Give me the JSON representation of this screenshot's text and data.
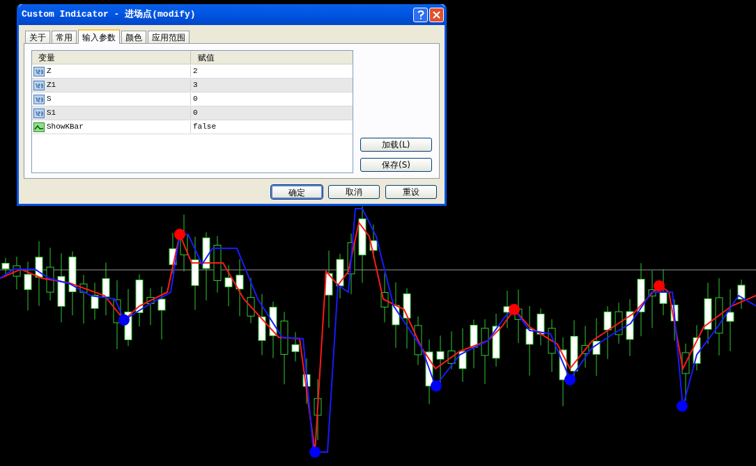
{
  "window": {
    "title": "Custom Indicator - 进场点(modify)"
  },
  "tabs": [
    {
      "label": "关于",
      "selected": false
    },
    {
      "label": "常用",
      "selected": false
    },
    {
      "label": "输入参数",
      "selected": true
    },
    {
      "label": "颜色",
      "selected": false
    },
    {
      "label": "应用范围",
      "selected": false
    }
  ],
  "table": {
    "columns": [
      "变量",
      "赋值"
    ],
    "rows": [
      {
        "kind": "number",
        "name": "Z",
        "value": "2"
      },
      {
        "kind": "number",
        "name": "Z1",
        "value": "3"
      },
      {
        "kind": "number",
        "name": "S",
        "value": "0"
      },
      {
        "kind": "number",
        "name": "S1",
        "value": "0"
      },
      {
        "kind": "boolean",
        "name": "ShowKBar",
        "value": "false"
      }
    ]
  },
  "side_buttons": [
    "加载(L)",
    "保存(S)"
  ],
  "buttons": [
    {
      "label": "确定",
      "default": true
    },
    {
      "label": "取消",
      "default": false
    },
    {
      "label": "重设",
      "default": false
    }
  ]
}
